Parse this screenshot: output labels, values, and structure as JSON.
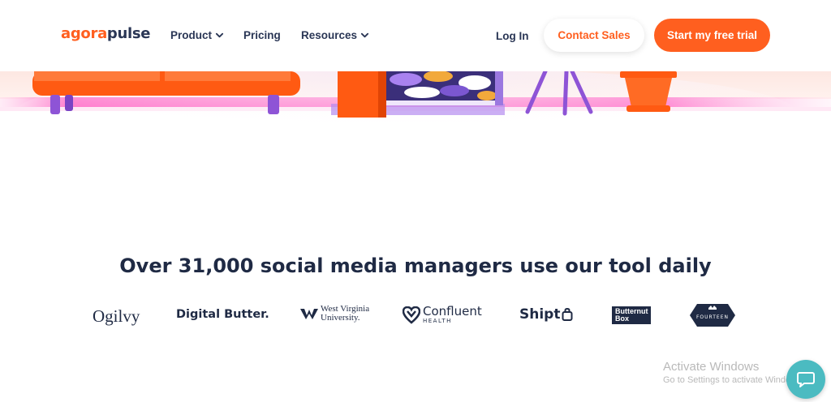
{
  "header": {
    "logo_part1": "agora",
    "logo_part2": "pulse",
    "nav": {
      "product": "Product",
      "pricing": "Pricing",
      "resources": "Resources"
    },
    "login": "Log In",
    "contact_sales": "Contact Sales",
    "free_trial": "Start my free trial"
  },
  "social_proof": {
    "headline": "Over 31,000 social media managers use our tool daily",
    "logos": {
      "ogilvy": "Ogilvy",
      "digital_butter": "Digital Butter.",
      "wvu_line1": "West Virginia",
      "wvu_line2": "University.",
      "confluent": "Confluent",
      "confluent_sub": "HEALTH",
      "shipt": "Shipt",
      "butternut_line1": "Butternut",
      "butternut_line2": "Box",
      "fourteen": "FOURTEEN"
    }
  },
  "watermark": {
    "title": "Activate Windows",
    "subtitle": "Go to Settings to activate Windows."
  },
  "colors": {
    "brand_orange": "#ff5f1f",
    "navy": "#1f2a44",
    "chat_teal": "#4bbbc1"
  },
  "icons": {
    "product_chevron": "chevron-down-icon",
    "resources_chevron": "chevron-down-icon",
    "chat": "chat-bubble-icon"
  }
}
